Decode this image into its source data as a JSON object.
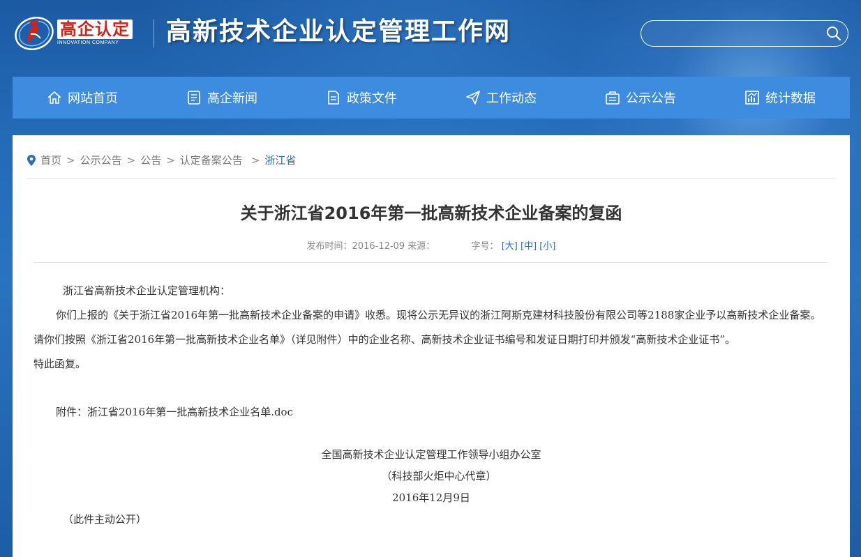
{
  "header": {
    "logo_cn": "高企认定",
    "logo_en": "INNOVATION COMPANY",
    "site_title": "高新技术企业认定管理工作网",
    "search_placeholder": ""
  },
  "nav": {
    "items": [
      {
        "label": "网站首页",
        "icon": "home-icon"
      },
      {
        "label": "高企新闻",
        "icon": "news-icon"
      },
      {
        "label": "政策文件",
        "icon": "document-icon"
      },
      {
        "label": "工作动态",
        "icon": "send-icon"
      },
      {
        "label": "公示公告",
        "icon": "notice-icon"
      },
      {
        "label": "统计数据",
        "icon": "chart-icon"
      }
    ]
  },
  "breadcrumb": {
    "items": [
      "首页",
      "公示公告",
      "公告",
      "认定备案公告"
    ],
    "current": "浙江省",
    "separator": ">"
  },
  "article": {
    "title": "关于浙江省2016年第一批高新技术企业备案的复函",
    "meta_date_label": "发布时间：2016-12-09",
    "meta_source_label": "来源：",
    "meta_fontsize_label": "字号：",
    "font_large": "[大]",
    "font_medium": "[中]",
    "font_small": "[小]",
    "salutation": "浙江省高新技术企业认定管理机构：",
    "paragraph": "你们上报的《关于浙江省2016年第一批高新技术企业备案的申请》收悉。现将公示无异议的浙江阿斯克建材科技股份有限公司等2188家企业予以高新技术企业备案。请你们按照《浙江省2016年第一批高新技术企业名单》（详见附件）中的企业名称、高新技术企业证书编号和发证日期打印并颁发“高新技术企业证书”。",
    "closing": "特此函复。",
    "attachment_label": "附件：",
    "attachment_file": "浙江省2016年第一批高新技术企业名单.doc",
    "signature_org": "全国高新技术企业认定管理工作领导小组办公室",
    "signature_proxy": "（科技部火炬中心代章）",
    "signature_date": "2016年12月9日",
    "disclosure": "（此件主动公开）"
  },
  "colors": {
    "nav_bg": "#3e8ce0",
    "header_bg": "#1f5fa8",
    "link": "#2f6db5",
    "logo_red": "#d0231a"
  }
}
